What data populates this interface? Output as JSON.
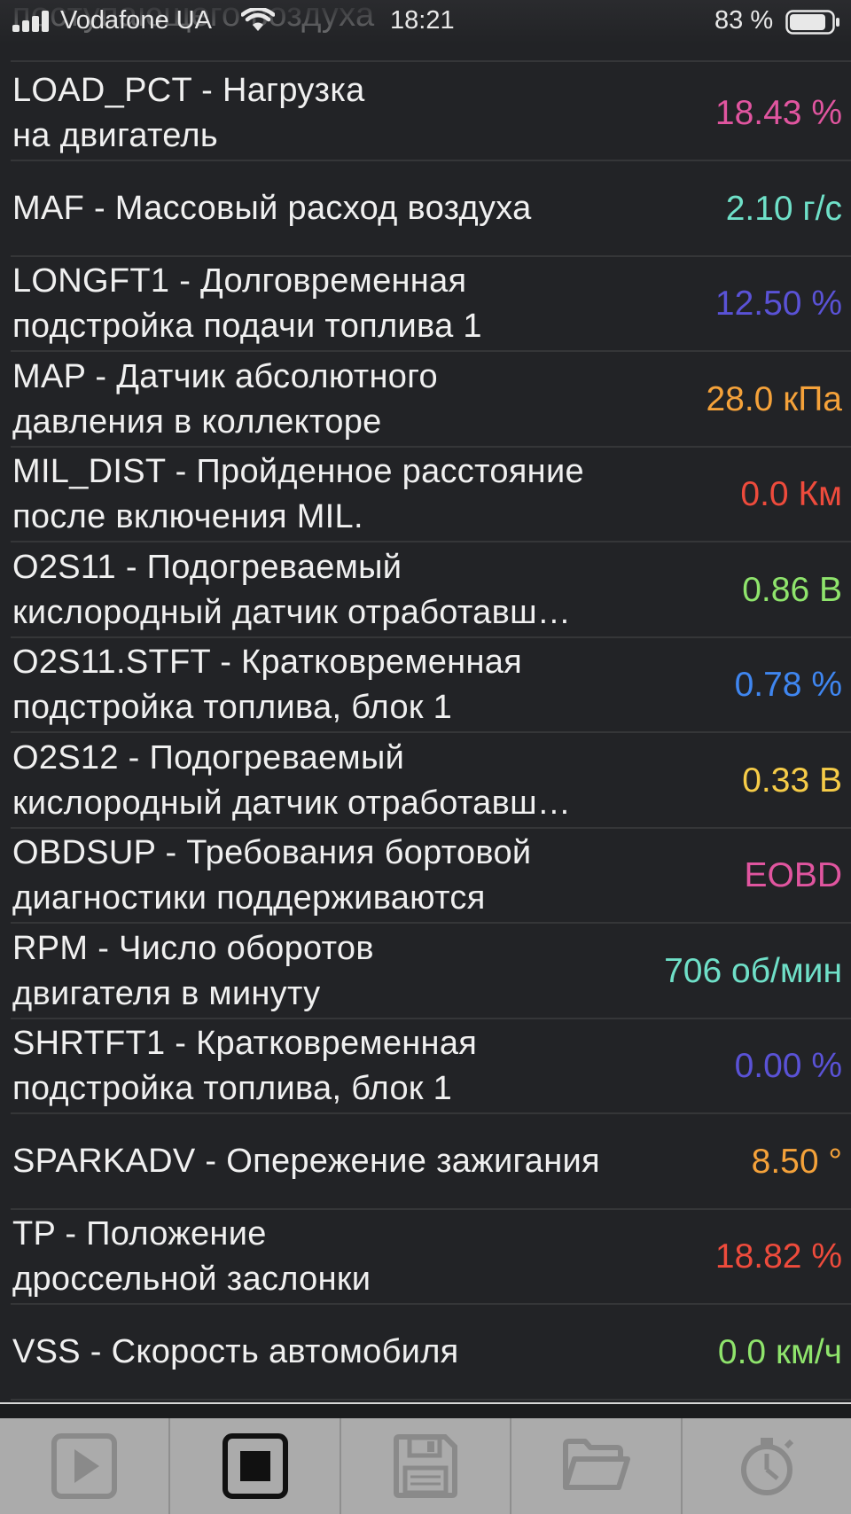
{
  "status_bar": {
    "carrier": "Vodafone UA",
    "time": "18:21",
    "battery": "83 %"
  },
  "header_partial": "поступающего воздуха",
  "pids": [
    {
      "name": "LOAD_PCT - Нагрузка\nна двигатель",
      "value": "18.43 %",
      "color": "#e0559f"
    },
    {
      "name": "MAF - Массовый расход воздуха",
      "value": "2.10 г/с",
      "color": "#6fe0c8"
    },
    {
      "name": "LONGFT1 - Долговременная\nподстройка подачи топлива 1",
      "value": "12.50 %",
      "color": "#5a52d6"
    },
    {
      "name": "MAP - Датчик абсолютного\nдавления в коллекторе",
      "value": "28.0 кПа",
      "color": "#f5a23a"
    },
    {
      "name": "MIL_DIST - Пройденное расстояние\nпосле включения MIL.",
      "value": "0.0 Км",
      "color": "#ee4b3c"
    },
    {
      "name": "O2S11 - Подогреваемый\nкислородный датчик отработавш…",
      "value": "0.86 В",
      "color": "#8fe46c"
    },
    {
      "name": "O2S11.STFT - Кратковременная\nподстройка топлива, блок 1",
      "value": "0.78 %",
      "color": "#3f86f0"
    },
    {
      "name": "O2S12 - Подогреваемый\nкислородный датчик отработавш…",
      "value": "0.33 В",
      "color": "#f6cc48"
    },
    {
      "name": "OBDSUP - Требования бортовой\nдиагностики поддерживаются",
      "value": "EOBD",
      "color": "#e0559f"
    },
    {
      "name": "RPM - Число оборотов\nдвигателя в минуту",
      "value": "706 об/мин",
      "color": "#6fe0c8"
    },
    {
      "name": "SHRTFT1 - Кратковременная\nподстройка топлива, блок 1",
      "value": "0.00 %",
      "color": "#5a52d6"
    },
    {
      "name": "SPARKADV - Опережение зажигания",
      "value": "8.50 °",
      "color": "#f5a23a"
    },
    {
      "name": "TP - Положение\nдроссельной заслонки",
      "value": "18.82 %",
      "color": "#ee4b3c"
    },
    {
      "name": "VSS - Скорость автомобиля",
      "value": "0.0 км/ч",
      "color": "#8fe46c"
    }
  ],
  "toolbar": [
    {
      "name": "play-button",
      "icon": "play-icon"
    },
    {
      "name": "stop-button",
      "icon": "stop-icon"
    },
    {
      "name": "save-button",
      "icon": "floppy-disk-icon"
    },
    {
      "name": "open-folder-button",
      "icon": "folder-icon"
    },
    {
      "name": "dashboard-button",
      "icon": "gauge-icon"
    }
  ]
}
